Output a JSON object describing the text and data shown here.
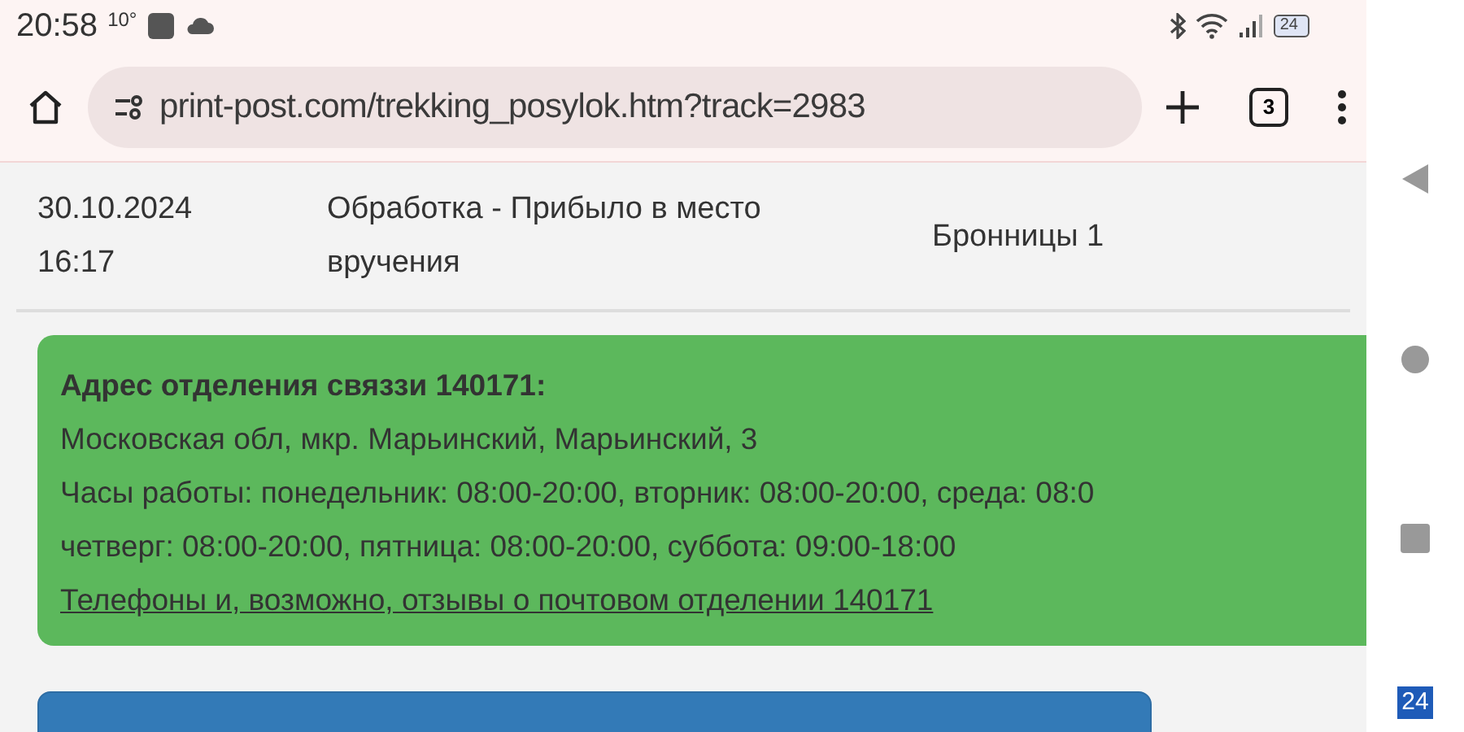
{
  "status_bar": {
    "time": "20:58",
    "temperature": "10°",
    "battery": "24"
  },
  "browser": {
    "url": "print-post.com/trekking_posylok.htm?track=2983",
    "tab_count": "3"
  },
  "tracking_row": {
    "date": "30.10.2024",
    "time": "16:17",
    "status": "Обработка - Прибыло в место вручения",
    "location": "Бронницы 1"
  },
  "office_card": {
    "title": "Адрес отделения связзи 140171:",
    "address": "Московская обл, мкр. Марьинский, Марьинский, 3",
    "hours": [
      "Часы работы: понедельник: 08:00-20:00, вторник: 08:00-20:00, среда: 08:0",
      "четверг: 08:00-20:00, пятница: 08:00-20:00, суббота: 09:00-18:00"
    ],
    "link": "Телефоны и, возможно, отзывы о почтовом отделении 140171"
  },
  "nav_bar": {
    "badge": "24"
  }
}
